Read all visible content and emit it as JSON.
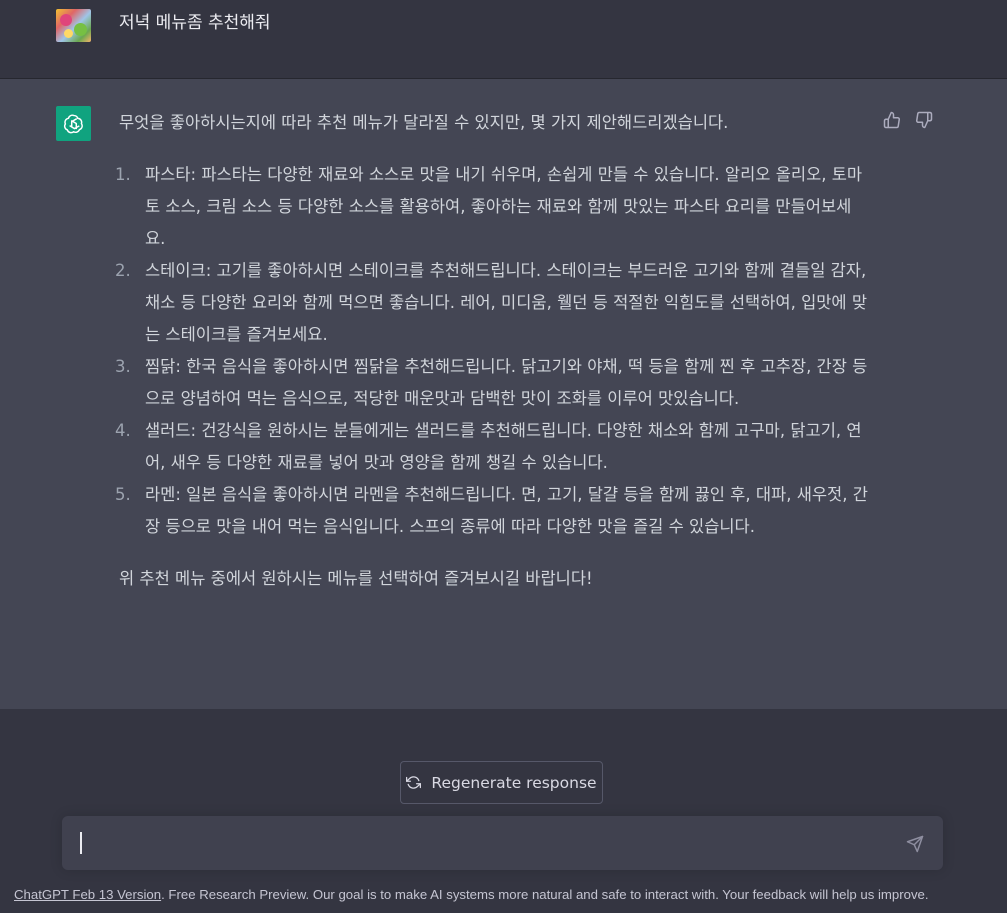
{
  "user_message": {
    "text": "저녁 메뉴좀 추천해줘"
  },
  "assistant_message": {
    "intro": "무엇을 좋아하시는지에 따라 추천 메뉴가 달라질 수 있지만, 몇 가지 제안해드리겠습니다.",
    "items": [
      {
        "num": "1.",
        "text": "파스타: 파스타는 다양한 재료와 소스로 맛을 내기 쉬우며, 손쉽게 만들 수 있습니다. 알리오 올리오, 토마토 소스, 크림 소스 등 다양한 소스를 활용하여, 좋아하는 재료와 함께 맛있는 파스타 요리를 만들어보세요."
      },
      {
        "num": "2.",
        "text": "스테이크: 고기를 좋아하시면 스테이크를 추천해드립니다. 스테이크는 부드러운 고기와 함께 곁들일 감자, 채소 등 다양한 요리와 함께 먹으면 좋습니다. 레어, 미디움, 웰던 등 적절한 익힘도를 선택하여, 입맛에 맞는 스테이크를 즐겨보세요."
      },
      {
        "num": "3.",
        "text": "찜닭: 한국 음식을 좋아하시면 찜닭을 추천해드립니다. 닭고기와 야채, 떡 등을 함께 찐 후 고추장, 간장 등으로 양념하여 먹는 음식으로, 적당한 매운맛과 담백한 맛이 조화를 이루어 맛있습니다."
      },
      {
        "num": "4.",
        "text": "샐러드: 건강식을 원하시는 분들에게는 샐러드를 추천해드립니다. 다양한 채소와 함께 고구마, 닭고기, 연어, 새우 등 다양한 재료를 넣어 맛과 영양을 함께 챙길 수 있습니다."
      },
      {
        "num": "5.",
        "text": "라멘: 일본 음식을 좋아하시면 라멘을 추천해드립니다. 면, 고기, 달걀 등을 함께 끓인 후, 대파, 새우젓, 간장 등으로 맛을 내어 먹는 음식입니다. 스프의 종류에 따라 다양한 맛을 즐길 수 있습니다."
      }
    ],
    "closing": "위 추천 메뉴 중에서 원하시는 메뉴를 선택하여 즐겨보시길 바랍니다!"
  },
  "icons": {
    "user_avatar": "user-avatar-image",
    "gpt_logo": "openai-logo-icon",
    "thumbs_up": "thumbs-up-icon",
    "thumbs_down": "thumbs-down-icon",
    "regenerate": "refresh-icon",
    "send": "send-icon"
  },
  "regenerate": {
    "label": "Regenerate response"
  },
  "composer": {
    "value": "",
    "placeholder": ""
  },
  "footer": {
    "link_text": "ChatGPT Feb 13 Version",
    "text": ". Free Research Preview. Our goal is to make AI systems more natural and safe to interact with. Your feedback will help us improve."
  },
  "colors": {
    "background": "#343541",
    "assistant_background": "#444654",
    "gpt_brand": "#10a37f",
    "input_background": "#40414f"
  }
}
